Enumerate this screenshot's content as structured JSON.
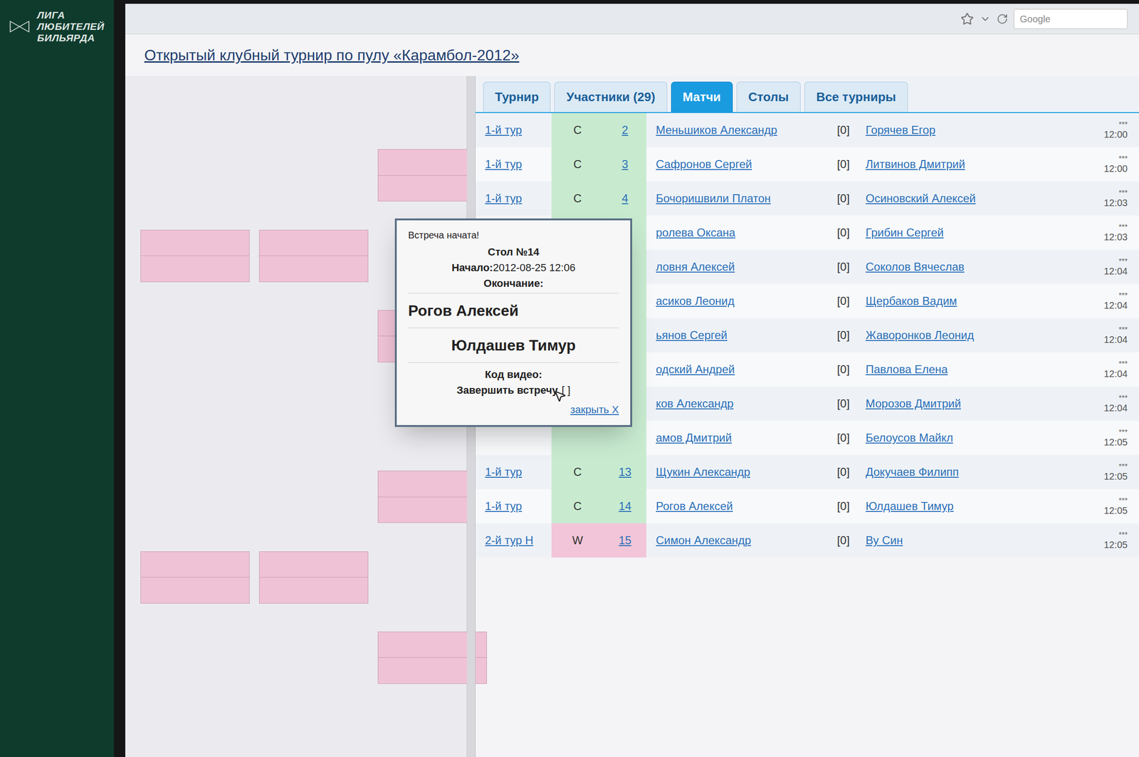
{
  "logo": {
    "lines": [
      "ЛИГА",
      "ЛЮБИТЕЛЕЙ",
      "БИЛЬЯРДА"
    ]
  },
  "browser": {
    "search_placeholder": "Google"
  },
  "page_title": "Открытый клубный турнир по пулу «Карамбол-2012»",
  "tabs": [
    {
      "label": "Турнир",
      "selected": false
    },
    {
      "label": "Участники (29)",
      "selected": false
    },
    {
      "label": "Матчи",
      "selected": true
    },
    {
      "label": "Столы",
      "selected": false
    },
    {
      "label": "Все турниры",
      "selected": false
    }
  ],
  "matches": [
    {
      "round": "1-й тур",
      "status": "С",
      "color": "#c8ebd0",
      "table": "2",
      "player1": "Меньшиков Александр",
      "score": "[0]",
      "player2": "Горячев Егор",
      "stars": "***",
      "time": "12:00"
    },
    {
      "round": "1-й тур",
      "status": "С",
      "color": "#c8ebd0",
      "table": "3",
      "player1": "Сафронов Сергей",
      "score": "[0]",
      "player2": "Литвинов Дмитрий",
      "stars": "***",
      "time": "12:00"
    },
    {
      "round": "1-й тур",
      "status": "С",
      "color": "#c8ebd0",
      "table": "4",
      "player1": "Бочоришвили Платон",
      "score": "[0]",
      "player2": "Осиновский Алексей",
      "stars": "***",
      "time": "12:03"
    },
    {
      "round": "",
      "status": "",
      "color": "#c8ebd0",
      "table": "",
      "player1": "ролева Оксана",
      "score": "[0]",
      "player2": "Грибин Сергей",
      "stars": "***",
      "time": "12:03"
    },
    {
      "round": "",
      "status": "",
      "color": "#c8ebd0",
      "table": "",
      "player1": "ловня Алексей",
      "score": "[0]",
      "player2": "Соколов Вячеслав",
      "stars": "***",
      "time": "12:04"
    },
    {
      "round": "",
      "status": "",
      "color": "#c8ebd0",
      "table": "",
      "player1": "асиков Леонид",
      "score": "[0]",
      "player2": "Щербаков Вадим",
      "stars": "***",
      "time": "12:04"
    },
    {
      "round": "",
      "status": "",
      "color": "#c8ebd0",
      "table": "",
      "player1": "ьянов Сергей",
      "score": "[0]",
      "player2": "Жаворонков Леонид",
      "stars": "***",
      "time": "12:04"
    },
    {
      "round": "",
      "status": "",
      "color": "#c8ebd0",
      "table": "",
      "player1": "одский Андрей",
      "score": "[0]",
      "player2": "Павлова Елена",
      "stars": "***",
      "time": "12:04"
    },
    {
      "round": "",
      "status": "",
      "color": "#c8ebd0",
      "table": "",
      "player1": "ков Александр",
      "score": "[0]",
      "player2": "Морозов Дмитрий",
      "stars": "***",
      "time": "12:04"
    },
    {
      "round": "",
      "status": "",
      "color": "#c8ebd0",
      "table": "",
      "player1": "амов Дмитрий",
      "score": "[0]",
      "player2": "Белоусов Майкл",
      "stars": "***",
      "time": "12:05"
    },
    {
      "round": "1-й тур",
      "status": "С",
      "color": "#c8ebd0",
      "table": "13",
      "player1": "Щукин Александр",
      "score": "[0]",
      "player2": "Докучаев Филипп",
      "stars": "***",
      "time": "12:05"
    },
    {
      "round": "1-й тур",
      "status": "С",
      "color": "#c8ebd0",
      "table": "14",
      "player1": "Рогов Алексей",
      "score": "[0]",
      "player2": "Юлдашев Тимур",
      "stars": "***",
      "time": "12:05"
    },
    {
      "round": "2-й тур Н",
      "status": "W",
      "color": "#f2c6d8",
      "table": "15",
      "player1": "Симон Александр",
      "score": "[0]",
      "player2": "Ву Син",
      "stars": "***",
      "time": "12:05"
    }
  ],
  "popup": {
    "heading": "Встреча начата!",
    "table": "Стол №14",
    "start_label": "Начало:",
    "start": "2012-08-25 12:06",
    "end_label": "Окончание:",
    "player1": "Рогов Алексей",
    "player2": "Юлдашев Тимур",
    "video_label": "Код видео:",
    "finish_label": "Завершить встречу",
    "finish_box": "[ ]",
    "close": "закрыть X"
  }
}
